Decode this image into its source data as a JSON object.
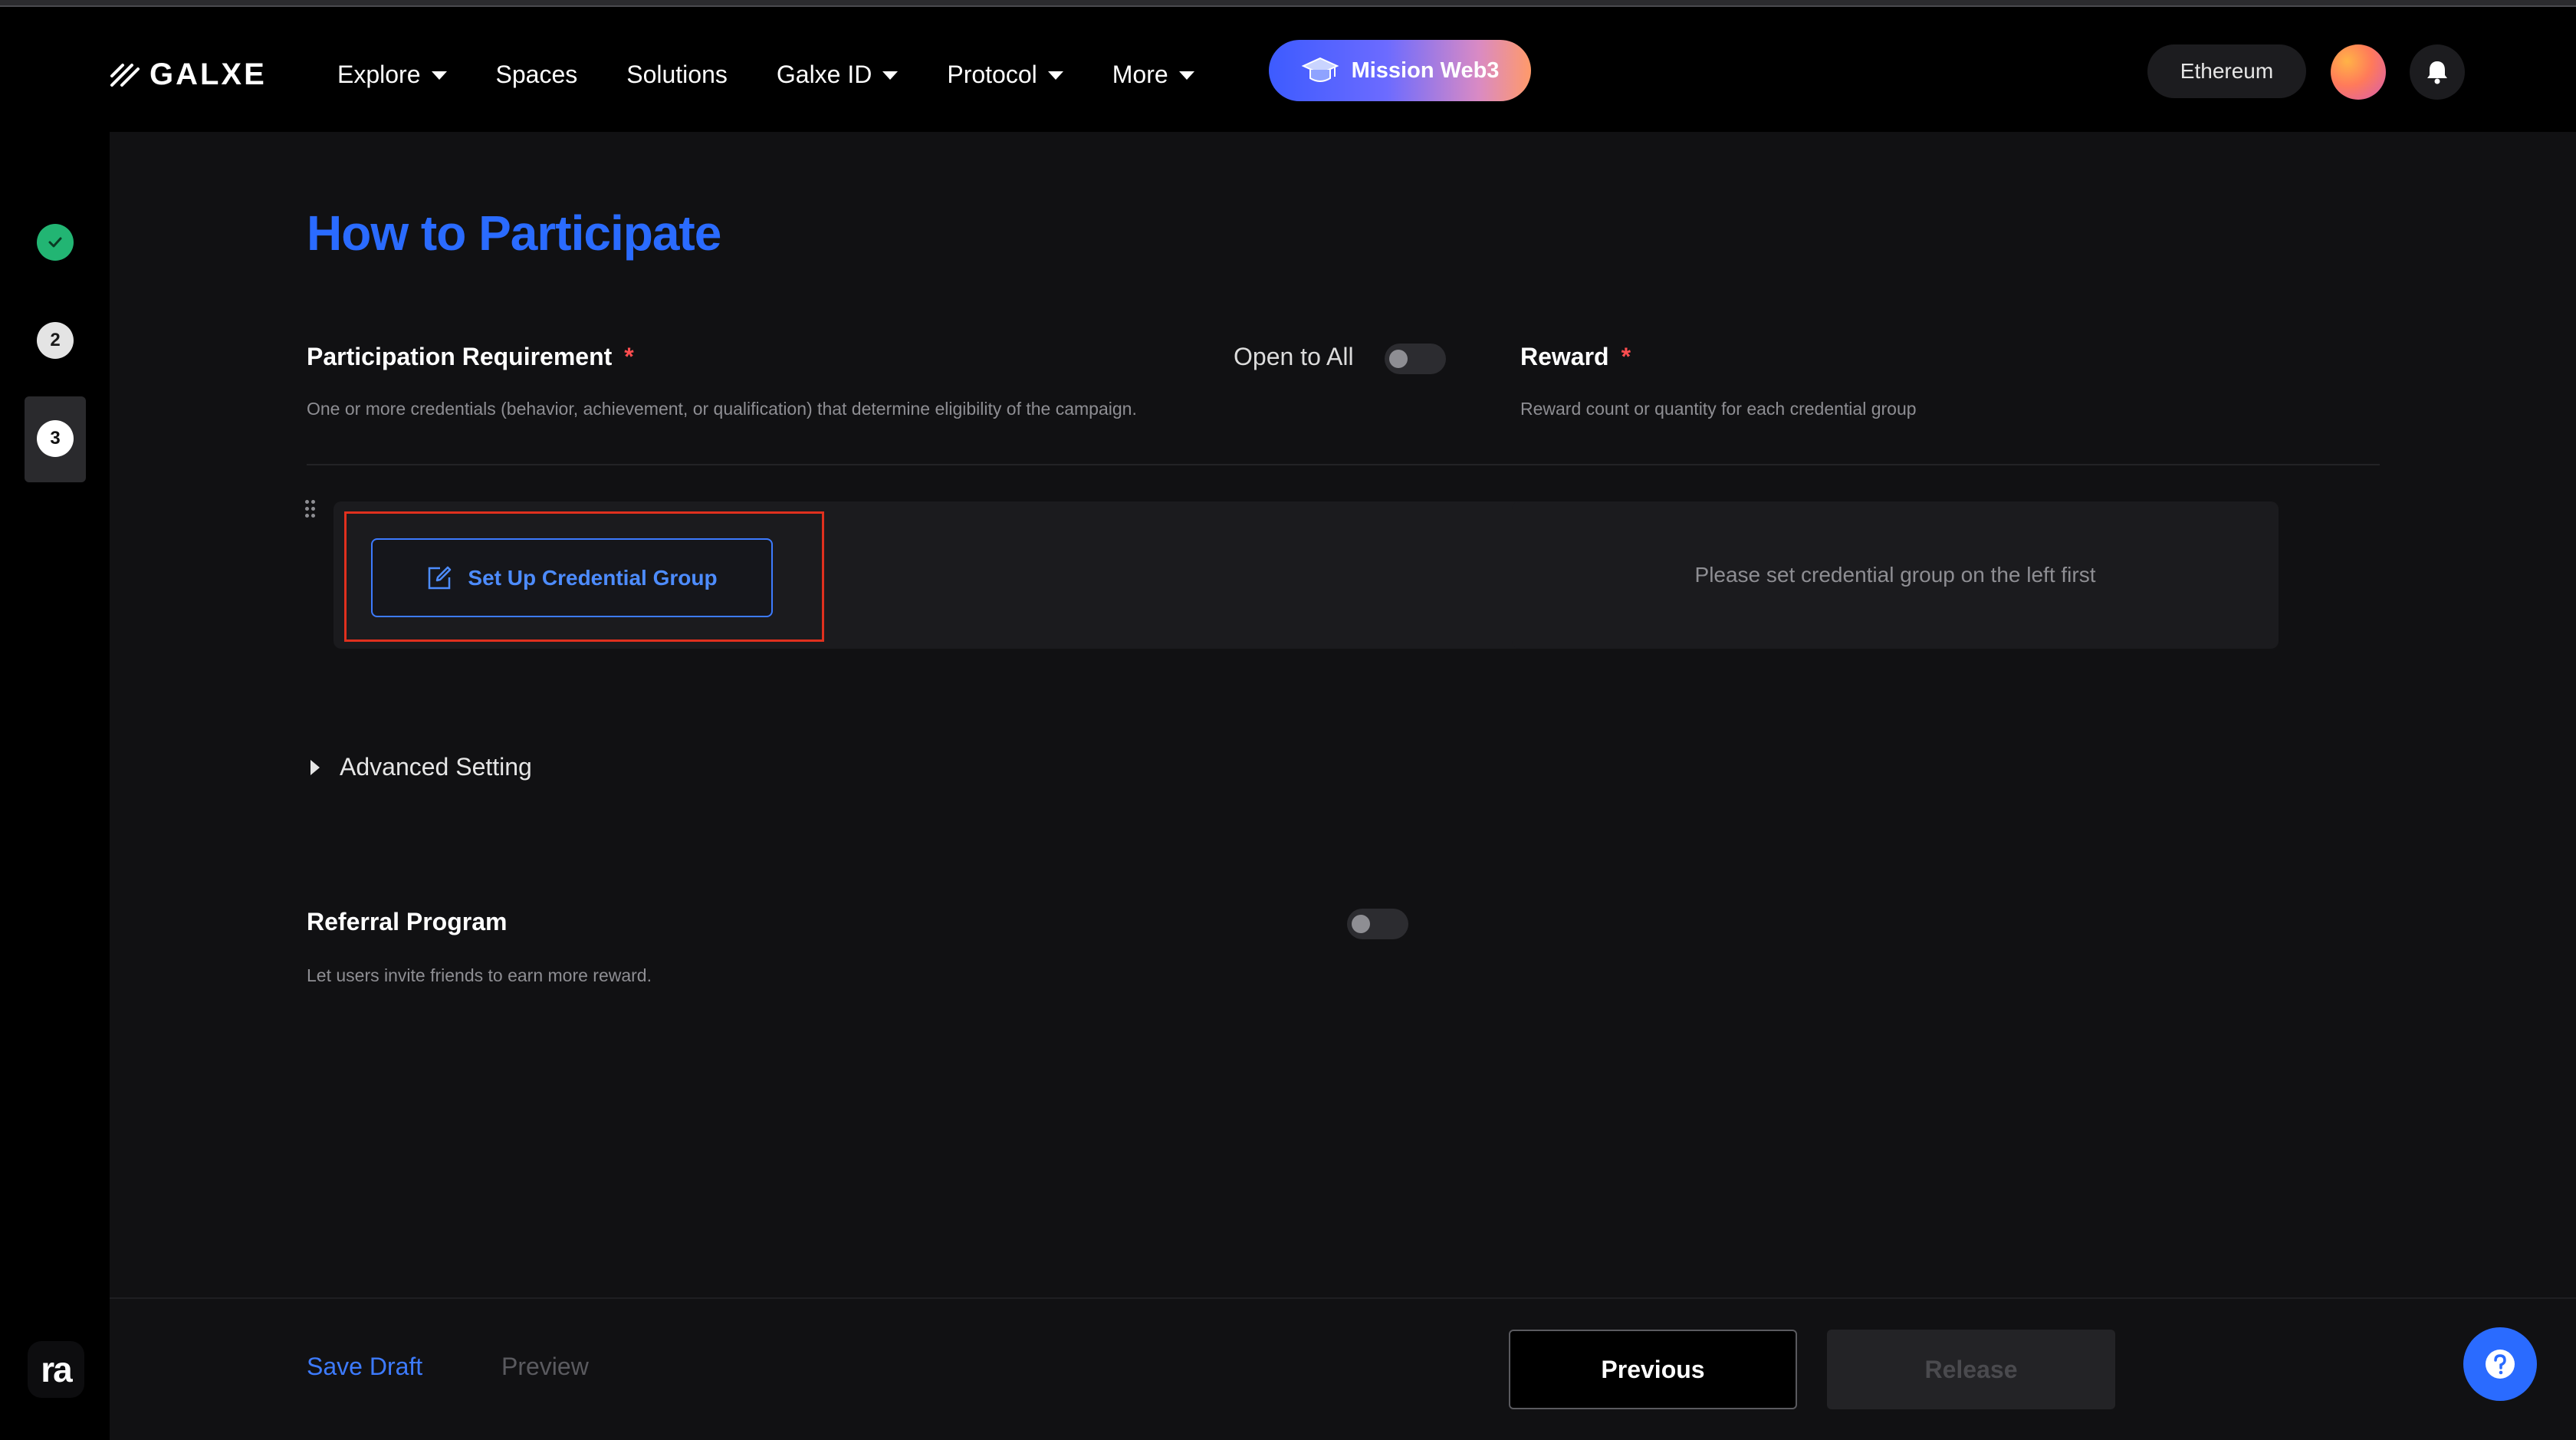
{
  "header": {
    "logo_text": "GALXE",
    "nav": [
      {
        "label": "Explore",
        "has_dropdown": true
      },
      {
        "label": "Spaces",
        "has_dropdown": false
      },
      {
        "label": "Solutions",
        "has_dropdown": false
      },
      {
        "label": "Galxe ID",
        "has_dropdown": true
      },
      {
        "label": "Protocol",
        "has_dropdown": true
      },
      {
        "label": "More",
        "has_dropdown": true
      }
    ],
    "mission_label": "Mission Web3",
    "network_label": "Ethereum",
    "icons": {
      "bell": "bell-icon",
      "avatar": "avatar",
      "mission": "graduation-cap-icon"
    }
  },
  "steps": [
    {
      "state": "done",
      "icon": "check-icon"
    },
    {
      "state": "pending",
      "number": "2"
    },
    {
      "state": "active",
      "number": "3"
    }
  ],
  "main": {
    "title": "How to Participate",
    "participation": {
      "label": "Participation Requirement",
      "required_mark": "*",
      "description": "One or more credentials (behavior, achievement, or qualification) that determine eligibility of the campaign.",
      "open_to_all_label": "Open to All",
      "open_to_all_enabled": false,
      "setup_button": "Set Up Credential Group"
    },
    "reward": {
      "label": "Reward",
      "required_mark": "*",
      "description": "Reward count or quantity for each credential group",
      "placeholder": "Please set credential group on the left first"
    },
    "advanced": {
      "label": "Advanced Setting",
      "expanded": false
    },
    "referral": {
      "label": "Referral Program",
      "description": "Let users invite friends to earn more reward.",
      "enabled": false
    }
  },
  "footer": {
    "save_draft": "Save Draft",
    "preview": "Preview",
    "previous": "Previous",
    "release": "Release",
    "help_icon": "help-icon"
  },
  "colors": {
    "accent": "#2a6bff",
    "required": "#ff4d4f",
    "success": "#22b573",
    "highlight_box": "#e0301e"
  },
  "sidebar_brand": "ra"
}
